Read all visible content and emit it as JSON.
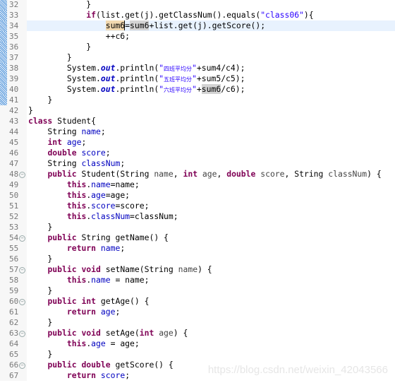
{
  "editor": {
    "current_line": 34,
    "lines": [
      {
        "n": 32,
        "m": 1,
        "t": [
          [
            "p",
            "            }"
          ]
        ]
      },
      {
        "n": 33,
        "m": 1,
        "t": [
          [
            "p",
            "            "
          ],
          [
            "k",
            "if"
          ],
          [
            "p",
            "(list.get(j).getClassNum().equals("
          ],
          [
            "s",
            "\"class06\""
          ],
          [
            "p",
            "){"
          ]
        ]
      },
      {
        "n": 34,
        "m": 1,
        "t": [
          [
            "p",
            "                "
          ],
          [
            "h1",
            "sum6"
          ],
          [
            "caret",
            "="
          ],
          [
            "h2",
            "sum6"
          ],
          [
            "p",
            "+list.get(j).getScore();"
          ]
        ]
      },
      {
        "n": 35,
        "m": 1,
        "t": [
          [
            "p",
            "                ++c6;"
          ]
        ]
      },
      {
        "n": 36,
        "m": 1,
        "t": [
          [
            "p",
            "            }"
          ]
        ]
      },
      {
        "n": 37,
        "m": 1,
        "t": [
          [
            "p",
            "        }"
          ]
        ]
      },
      {
        "n": 38,
        "m": 1,
        "t": [
          [
            "p",
            "        System."
          ],
          [
            "o",
            "out"
          ],
          [
            "p",
            ".println("
          ],
          [
            "s",
            "\""
          ],
          [
            "cn",
            "四班平均分"
          ],
          [
            "s",
            "\""
          ],
          [
            "p",
            "+sum4/c4);"
          ]
        ]
      },
      {
        "n": 39,
        "m": 1,
        "t": [
          [
            "p",
            "        System."
          ],
          [
            "o",
            "out"
          ],
          [
            "p",
            ".println("
          ],
          [
            "s",
            "\""
          ],
          [
            "cn",
            "五班平均分"
          ],
          [
            "s",
            "\""
          ],
          [
            "p",
            "+sum5/c5);"
          ]
        ]
      },
      {
        "n": 40,
        "m": 1,
        "t": [
          [
            "p",
            "        System."
          ],
          [
            "o",
            "out"
          ],
          [
            "p",
            ".println("
          ],
          [
            "s",
            "\""
          ],
          [
            "cn",
            "六班平均分"
          ],
          [
            "s",
            "\""
          ],
          [
            "p",
            "+"
          ],
          [
            "h2",
            "sum6"
          ],
          [
            "p",
            "/c6);"
          ]
        ]
      },
      {
        "n": 41,
        "m": 1,
        "t": [
          [
            "p",
            "    }"
          ]
        ]
      },
      {
        "n": 42,
        "t": [
          [
            "p",
            "}"
          ]
        ]
      },
      {
        "n": 43,
        "t": [
          [
            "k",
            "class"
          ],
          [
            "p",
            " Student{"
          ]
        ]
      },
      {
        "n": 44,
        "t": [
          [
            "p",
            "    String "
          ],
          [
            "f",
            "name"
          ],
          [
            "p",
            ";"
          ]
        ]
      },
      {
        "n": 45,
        "t": [
          [
            "p",
            "    "
          ],
          [
            "k",
            "int"
          ],
          [
            "p",
            " "
          ],
          [
            "f",
            "age"
          ],
          [
            "p",
            ";"
          ]
        ]
      },
      {
        "n": 46,
        "t": [
          [
            "p",
            "    "
          ],
          [
            "k",
            "double"
          ],
          [
            "p",
            " "
          ],
          [
            "f",
            "score"
          ],
          [
            "p",
            ";"
          ]
        ]
      },
      {
        "n": 47,
        "t": [
          [
            "p",
            "    String "
          ],
          [
            "f",
            "classNum"
          ],
          [
            "p",
            ";"
          ]
        ]
      },
      {
        "n": 48,
        "fold": 1,
        "t": [
          [
            "p",
            "    "
          ],
          [
            "k",
            "public"
          ],
          [
            "p",
            " Student(String "
          ],
          [
            "v",
            "name"
          ],
          [
            "p",
            ", "
          ],
          [
            "k",
            "int"
          ],
          [
            "p",
            " "
          ],
          [
            "v",
            "age"
          ],
          [
            "p",
            ", "
          ],
          [
            "k",
            "double"
          ],
          [
            "p",
            " "
          ],
          [
            "v",
            "score"
          ],
          [
            "p",
            ", String "
          ],
          [
            "v",
            "classNum"
          ],
          [
            "p",
            ") {"
          ]
        ]
      },
      {
        "n": 49,
        "t": [
          [
            "p",
            "        "
          ],
          [
            "k",
            "this"
          ],
          [
            "p",
            "."
          ],
          [
            "f",
            "name"
          ],
          [
            "p",
            "=name;"
          ]
        ]
      },
      {
        "n": 50,
        "t": [
          [
            "p",
            "        "
          ],
          [
            "k",
            "this"
          ],
          [
            "p",
            "."
          ],
          [
            "f",
            "age"
          ],
          [
            "p",
            "=age;"
          ]
        ]
      },
      {
        "n": 51,
        "t": [
          [
            "p",
            "        "
          ],
          [
            "k",
            "this"
          ],
          [
            "p",
            "."
          ],
          [
            "f",
            "score"
          ],
          [
            "p",
            "=score;"
          ]
        ]
      },
      {
        "n": 52,
        "t": [
          [
            "p",
            "        "
          ],
          [
            "k",
            "this"
          ],
          [
            "p",
            "."
          ],
          [
            "f",
            "classNum"
          ],
          [
            "p",
            "=classNum;"
          ]
        ]
      },
      {
        "n": 53,
        "t": [
          [
            "p",
            "    }"
          ]
        ]
      },
      {
        "n": 54,
        "fold": 1,
        "t": [
          [
            "p",
            "    "
          ],
          [
            "k",
            "public"
          ],
          [
            "p",
            " String getName() {"
          ]
        ]
      },
      {
        "n": 55,
        "t": [
          [
            "p",
            "        "
          ],
          [
            "k",
            "return"
          ],
          [
            "p",
            " "
          ],
          [
            "f",
            "name"
          ],
          [
            "p",
            ";"
          ]
        ]
      },
      {
        "n": 56,
        "t": [
          [
            "p",
            "    }"
          ]
        ]
      },
      {
        "n": 57,
        "fold": 1,
        "t": [
          [
            "p",
            "    "
          ],
          [
            "k",
            "public"
          ],
          [
            "p",
            " "
          ],
          [
            "k",
            "void"
          ],
          [
            "p",
            " setName(String "
          ],
          [
            "v",
            "name"
          ],
          [
            "p",
            ") {"
          ]
        ]
      },
      {
        "n": 58,
        "t": [
          [
            "p",
            "        "
          ],
          [
            "k",
            "this"
          ],
          [
            "p",
            "."
          ],
          [
            "f",
            "name"
          ],
          [
            "p",
            " = name;"
          ]
        ]
      },
      {
        "n": 59,
        "t": [
          [
            "p",
            "    }"
          ]
        ]
      },
      {
        "n": 60,
        "fold": 1,
        "t": [
          [
            "p",
            "    "
          ],
          [
            "k",
            "public"
          ],
          [
            "p",
            " "
          ],
          [
            "k",
            "int"
          ],
          [
            "p",
            " getAge() {"
          ]
        ]
      },
      {
        "n": 61,
        "t": [
          [
            "p",
            "        "
          ],
          [
            "k",
            "return"
          ],
          [
            "p",
            " "
          ],
          [
            "f",
            "age"
          ],
          [
            "p",
            ";"
          ]
        ]
      },
      {
        "n": 62,
        "t": [
          [
            "p",
            "    }"
          ]
        ]
      },
      {
        "n": 63,
        "fold": 1,
        "t": [
          [
            "p",
            "    "
          ],
          [
            "k",
            "public"
          ],
          [
            "p",
            " "
          ],
          [
            "k",
            "void"
          ],
          [
            "p",
            " setAge("
          ],
          [
            "k",
            "int"
          ],
          [
            "p",
            " "
          ],
          [
            "v",
            "age"
          ],
          [
            "p",
            ") {"
          ]
        ]
      },
      {
        "n": 64,
        "t": [
          [
            "p",
            "        "
          ],
          [
            "k",
            "this"
          ],
          [
            "p",
            "."
          ],
          [
            "f",
            "age"
          ],
          [
            "p",
            " = age;"
          ]
        ]
      },
      {
        "n": 65,
        "t": [
          [
            "p",
            "    }"
          ]
        ]
      },
      {
        "n": 66,
        "fold": 1,
        "t": [
          [
            "p",
            "    "
          ],
          [
            "k",
            "public"
          ],
          [
            "p",
            " "
          ],
          [
            "k",
            "double"
          ],
          [
            "p",
            " getScore() {"
          ]
        ]
      },
      {
        "n": 67,
        "t": [
          [
            "p",
            "        "
          ],
          [
            "k",
            "return"
          ],
          [
            "p",
            " "
          ],
          [
            "f",
            "score"
          ],
          [
            "p",
            ";"
          ]
        ]
      }
    ]
  },
  "watermark": "https://blog.csdn.net/weixin_42043566",
  "colors": {
    "keyword": "#7F0055",
    "string": "#2A00FF",
    "field": "#0000C0",
    "current_line": "#E8F2FE"
  }
}
